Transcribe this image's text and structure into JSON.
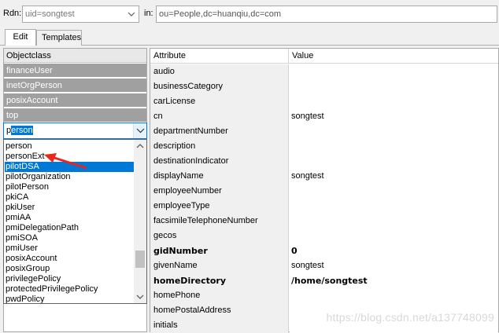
{
  "header": {
    "rdn_label": "Rdn:",
    "rdn_value": "uid=songtest",
    "in_label": "in:",
    "in_value": "ou=People,dc=huanqiu,dc=com"
  },
  "tabs": [
    {
      "label": "Edit",
      "active": true
    },
    {
      "label": "Templates",
      "active": false
    }
  ],
  "objectclass": {
    "header": "Objectclass",
    "items": [
      "financeUser",
      "inetOrgPerson",
      "posixAccount",
      "top"
    ],
    "combo_value_typed": "p",
    "combo_value_selected": "erson",
    "dropdown": [
      "person",
      "personExt",
      "pilotDSA",
      "pilotOrganization",
      "pilotPerson",
      "pkiCA",
      "pkiUser",
      "pmiAA",
      "pmiDelegationPath",
      "pmiSOA",
      "pmiUser",
      "posixAccount",
      "posixGroup",
      "privilegePolicy",
      "protectedPrivilegePolicy",
      "pwdPolicy"
    ],
    "dropdown_selected_index": 2
  },
  "attributes": {
    "col_attribute": "Attribute",
    "col_value": "Value",
    "rows": [
      {
        "name": "audio",
        "value": "",
        "bold": false
      },
      {
        "name": "businessCategory",
        "value": "",
        "bold": false
      },
      {
        "name": "carLicense",
        "value": "",
        "bold": false
      },
      {
        "name": "cn",
        "value": "songtest",
        "bold": false
      },
      {
        "name": "departmentNumber",
        "value": "",
        "bold": false
      },
      {
        "name": "description",
        "value": "",
        "bold": false
      },
      {
        "name": "destinationIndicator",
        "value": "",
        "bold": false
      },
      {
        "name": "displayName",
        "value": "songtest",
        "bold": false
      },
      {
        "name": "employeeNumber",
        "value": "",
        "bold": false
      },
      {
        "name": "employeeType",
        "value": "",
        "bold": false
      },
      {
        "name": "facsimileTelephoneNumber",
        "value": "",
        "bold": false
      },
      {
        "name": "gecos",
        "value": "",
        "bold": false
      },
      {
        "name": "gidNumber",
        "value": "0",
        "bold": true
      },
      {
        "name": "givenName",
        "value": "songtest",
        "bold": false
      },
      {
        "name": "homeDirectory",
        "value": "/home/songtest",
        "bold": true
      },
      {
        "name": "homePhone",
        "value": "",
        "bold": false
      },
      {
        "name": "homePostalAddress",
        "value": "",
        "bold": false
      },
      {
        "name": "initials",
        "value": "",
        "bold": false
      }
    ]
  },
  "watermark": "https://blog.csdn.net/a137748099",
  "colors": {
    "selection": "#0078d7",
    "objectclass_item_bg": "#a0a0a0",
    "annotation_arrow": "#e8261c"
  }
}
